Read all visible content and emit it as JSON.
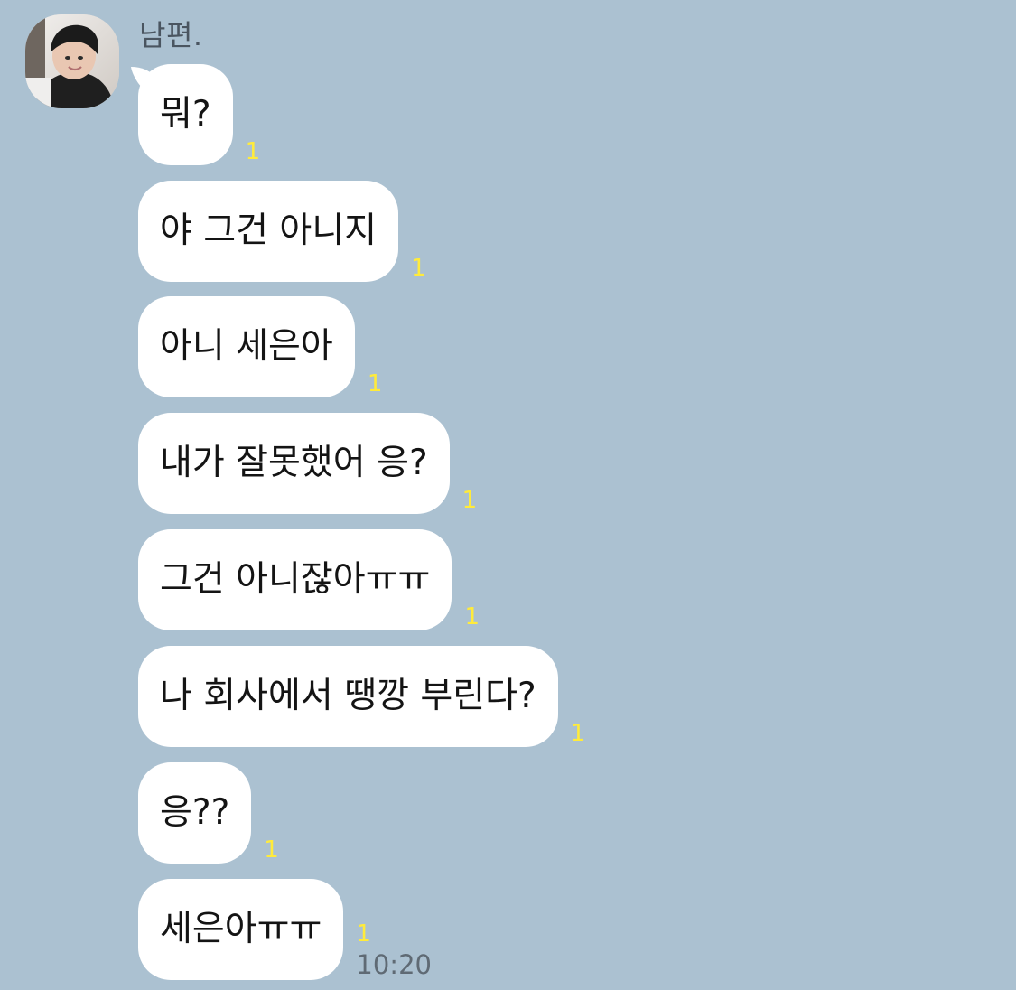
{
  "chat": {
    "sender": "남편.",
    "messages": [
      {
        "text": "뭐?",
        "unread": "1"
      },
      {
        "text": "야 그건 아니지",
        "unread": "1"
      },
      {
        "text": "아니 세은아",
        "unread": "1"
      },
      {
        "text": "내가 잘못했어 응?",
        "unread": "1"
      },
      {
        "text": "그건 아니잖아ㅠㅠ",
        "unread": "1"
      },
      {
        "text": "나 회사에서 땡깡 부린다?",
        "unread": "1"
      },
      {
        "text": "응??",
        "unread": "1"
      },
      {
        "text": "세은아ㅠㅠ",
        "unread": "1",
        "time": "10:20"
      }
    ]
  },
  "colors": {
    "background": "#abc1d1",
    "bubble": "#ffffff",
    "unread": "#ffeb3b"
  },
  "icons": {
    "avatar": "profile-photo"
  }
}
